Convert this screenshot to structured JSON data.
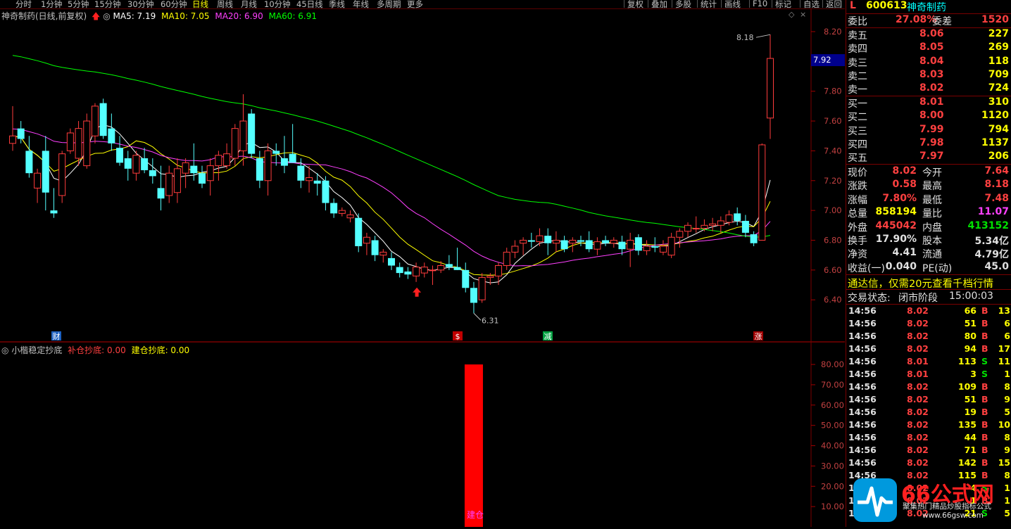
{
  "toolbar": {
    "timeframes": [
      "分时",
      "1分钟",
      "5分钟",
      "15分钟",
      "30分钟",
      "60分钟",
      "日线",
      "周线",
      "月线",
      "10分钟",
      "45日线",
      "季线",
      "年线",
      "多周期",
      "更多"
    ],
    "active_timeframe": "日线",
    "buttons": [
      "复权",
      "叠加",
      "多股",
      "统计",
      "画线",
      "F10",
      "标记",
      "自选",
      "返回"
    ]
  },
  "chart_header": {
    "title": "神奇制药(日线,前复权)",
    "ma5": "MA5: 7.19",
    "ma10": "MA10: 7.05",
    "ma20": "MA20: 6.90",
    "ma60": "MA60: 6.91",
    "colors": {
      "ma5": "#ffffff",
      "ma10": "#ffff00",
      "ma20": "#ff40ff",
      "ma60": "#00ff00"
    }
  },
  "price_axis": [
    "8.20",
    "8.00",
    "7.80",
    "7.60",
    "7.40",
    "7.20",
    "7.00",
    "6.80",
    "6.60",
    "6.40"
  ],
  "price_marker": "7.92",
  "high_label": "8.18",
  "low_label": "6.31",
  "event_markers": [
    "财",
    "$",
    "减",
    "涨"
  ],
  "indicator": {
    "name": "小楷稳定抄底",
    "line1": "补仓抄底: 0.00",
    "line2": "建仓抄底: 0.00",
    "axis": [
      "80.00",
      "70.00",
      "60.00",
      "50.00",
      "40.00",
      "30.00",
      "20.00",
      "10.00"
    ],
    "bar_label": "建仓",
    "bar_value": 80
  },
  "chart_data": {
    "type": "candlestick",
    "ylim": [
      6.3,
      8.25
    ],
    "candles": [
      [
        7.45,
        7.7,
        7.4,
        7.5
      ],
      [
        7.55,
        7.6,
        7.45,
        7.48
      ],
      [
        7.4,
        7.5,
        7.22,
        7.25
      ],
      [
        7.15,
        7.28,
        7.05,
        7.25
      ],
      [
        7.4,
        7.5,
        7.0,
        7.12
      ],
      [
        7.0,
        7.15,
        6.95,
        6.98
      ],
      [
        7.1,
        7.4,
        7.05,
        7.38
      ],
      [
        7.4,
        7.55,
        7.38,
        7.52
      ],
      [
        7.35,
        7.6,
        7.3,
        7.55
      ],
      [
        7.3,
        7.65,
        7.28,
        7.6
      ],
      [
        7.5,
        7.72,
        7.45,
        7.7
      ],
      [
        7.72,
        7.75,
        7.48,
        7.5
      ],
      [
        7.55,
        7.65,
        7.4,
        7.45
      ],
      [
        7.42,
        7.5,
        7.3,
        7.32
      ],
      [
        7.35,
        7.4,
        7.2,
        7.28
      ],
      [
        7.25,
        7.4,
        7.2,
        7.37
      ],
      [
        7.35,
        7.42,
        7.25,
        7.27
      ],
      [
        7.27,
        7.35,
        7.18,
        7.23
      ],
      [
        7.15,
        7.3,
        7.0,
        7.08
      ],
      [
        7.1,
        7.3,
        7.05,
        7.25
      ],
      [
        7.12,
        7.35,
        7.05,
        7.28
      ],
      [
        7.25,
        7.35,
        7.15,
        7.32
      ],
      [
        7.3,
        7.45,
        7.2,
        7.25
      ],
      [
        7.25,
        7.3,
        7.15,
        7.18
      ],
      [
        7.2,
        7.35,
        7.1,
        7.3
      ],
      [
        7.3,
        7.4,
        7.2,
        7.37
      ],
      [
        7.3,
        7.45,
        7.28,
        7.38
      ],
      [
        7.35,
        7.58,
        7.3,
        7.55
      ],
      [
        7.4,
        7.78,
        7.3,
        7.6
      ],
      [
        7.65,
        7.68,
        7.35,
        7.38
      ],
      [
        7.35,
        7.4,
        7.15,
        7.2
      ],
      [
        7.2,
        7.45,
        7.1,
        7.4
      ],
      [
        7.4,
        7.45,
        7.3,
        7.38
      ],
      [
        7.35,
        7.5,
        7.25,
        7.3
      ],
      [
        7.38,
        7.58,
        7.32,
        7.32
      ],
      [
        7.3,
        7.35,
        7.15,
        7.2
      ],
      [
        7.2,
        7.3,
        7.12,
        7.22
      ],
      [
        7.2,
        7.25,
        7.1,
        7.18
      ],
      [
        7.2,
        7.23,
        7.0,
        7.05
      ],
      [
        7.05,
        7.08,
        6.95,
        6.98
      ],
      [
        6.98,
        7.02,
        6.96,
        7.0
      ],
      [
        6.95,
        7.0,
        6.92,
        6.97
      ],
      [
        6.95,
        6.98,
        6.72,
        6.76
      ],
      [
        6.78,
        6.85,
        6.7,
        6.82
      ],
      [
        6.8,
        6.83,
        6.66,
        6.7
      ],
      [
        6.7,
        6.74,
        6.65,
        6.72
      ],
      [
        6.68,
        6.72,
        6.6,
        6.63
      ],
      [
        6.62,
        6.65,
        6.55,
        6.58
      ],
      [
        6.59,
        6.62,
        6.54,
        6.57
      ],
      [
        6.56,
        6.65,
        6.52,
        6.62
      ],
      [
        6.58,
        6.65,
        6.55,
        6.62
      ],
      [
        6.6,
        6.63,
        6.5,
        6.6
      ],
      [
        6.6,
        6.66,
        6.58,
        6.63
      ],
      [
        6.64,
        6.7,
        6.6,
        6.62
      ],
      [
        6.62,
        6.75,
        6.6,
        6.6
      ],
      [
        6.6,
        6.65,
        6.45,
        6.48
      ],
      [
        6.48,
        6.52,
        6.31,
        6.38
      ],
      [
        6.4,
        6.58,
        6.38,
        6.55
      ],
      [
        6.55,
        6.58,
        6.5,
        6.56
      ],
      [
        6.56,
        6.65,
        6.5,
        6.63
      ],
      [
        6.63,
        6.75,
        6.6,
        6.72
      ],
      [
        6.72,
        6.8,
        6.68,
        6.76
      ],
      [
        6.78,
        6.82,
        6.7,
        6.8
      ],
      [
        6.8,
        6.85,
        6.75,
        6.79
      ],
      [
        6.79,
        6.88,
        6.76,
        6.83
      ],
      [
        6.83,
        6.88,
        6.7,
        6.78
      ],
      [
        6.78,
        6.86,
        6.72,
        6.8
      ],
      [
        6.8,
        6.83,
        6.72,
        6.74
      ],
      [
        6.78,
        6.82,
        6.72,
        6.8
      ],
      [
        6.8,
        6.83,
        6.76,
        6.79
      ],
      [
        6.8,
        6.86,
        6.72,
        6.74
      ],
      [
        6.74,
        6.82,
        6.7,
        6.79
      ],
      [
        6.8,
        6.83,
        6.76,
        6.78
      ],
      [
        6.78,
        6.82,
        6.75,
        6.8
      ],
      [
        6.79,
        6.83,
        6.7,
        6.74
      ],
      [
        6.74,
        6.85,
        6.62,
        6.8
      ],
      [
        6.82,
        6.84,
        6.7,
        6.73
      ],
      [
        6.73,
        6.8,
        6.7,
        6.76
      ],
      [
        6.76,
        6.82,
        6.72,
        6.75
      ],
      [
        6.72,
        6.8,
        6.7,
        6.76
      ],
      [
        6.7,
        6.85,
        6.68,
        6.82
      ],
      [
        6.82,
        6.88,
        6.75,
        6.86
      ],
      [
        6.86,
        6.92,
        6.82,
        6.9
      ],
      [
        6.88,
        6.96,
        6.85,
        6.88
      ],
      [
        6.88,
        6.94,
        6.86,
        6.9
      ],
      [
        6.9,
        6.95,
        6.86,
        6.91
      ],
      [
        6.9,
        6.96,
        6.85,
        6.93
      ],
      [
        6.92,
        7.0,
        6.9,
        6.97
      ],
      [
        6.98,
        7.02,
        6.9,
        6.93
      ],
      [
        6.93,
        6.97,
        6.82,
        6.85
      ],
      [
        6.84,
        6.86,
        6.76,
        6.78
      ],
      [
        6.8,
        7.45,
        6.8,
        7.44
      ],
      [
        7.62,
        8.18,
        7.48,
        8.02
      ]
    ],
    "xlabel": "",
    "ylabel": ""
  },
  "quote": {
    "symbol_prefix": "L",
    "code": "600613",
    "name": "神奇制药",
    "weibi_label": "委比",
    "weibi": "27.08%",
    "weicha_label": "委差",
    "weicha": "1520",
    "asks": [
      {
        "label": "卖五",
        "price": "8.06",
        "vol": "227"
      },
      {
        "label": "卖四",
        "price": "8.05",
        "vol": "269"
      },
      {
        "label": "卖三",
        "price": "8.04",
        "vol": "118"
      },
      {
        "label": "卖二",
        "price": "8.03",
        "vol": "709"
      },
      {
        "label": "卖一",
        "price": "8.02",
        "vol": "724"
      }
    ],
    "bids": [
      {
        "label": "买一",
        "price": "8.01",
        "vol": "310"
      },
      {
        "label": "买二",
        "price": "8.00",
        "vol": "1120"
      },
      {
        "label": "买三",
        "price": "7.99",
        "vol": "794"
      },
      {
        "label": "买四",
        "price": "7.98",
        "vol": "1137"
      },
      {
        "label": "买五",
        "price": "7.97",
        "vol": "206"
      }
    ],
    "stats": [
      {
        "l1": "现价",
        "v1": "8.02",
        "c1": "red",
        "l2": "今开",
        "v2": "7.64",
        "c2": "red"
      },
      {
        "l1": "涨跌",
        "v1": "0.58",
        "c1": "red",
        "l2": "最高",
        "v2": "8.18",
        "c2": "red"
      },
      {
        "l1": "涨幅",
        "v1": "7.80%",
        "c1": "red",
        "l2": "最低",
        "v2": "7.48",
        "c2": "red"
      },
      {
        "l1": "总量",
        "v1": "858194",
        "c1": "yellow",
        "l2": "量比",
        "v2": "11.07",
        "c2": "mag"
      },
      {
        "l1": "外盘",
        "v1": "445042",
        "c1": "red",
        "l2": "内盘",
        "v2": "413152",
        "c2": "green"
      },
      {
        "l1": "换手",
        "v1": "17.90%",
        "c1": "white",
        "l2": "股本",
        "v2": "5.34亿",
        "c2": "white"
      },
      {
        "l1": "净资",
        "v1": "4.41",
        "c1": "white",
        "l2": "流通",
        "v2": "4.79亿",
        "c2": "white"
      },
      {
        "l1": "收益(一)",
        "v1": "0.040",
        "c1": "white",
        "l2": "PE(动)",
        "v2": "45.0",
        "c2": "white"
      }
    ],
    "notice": "通达信，仅需20元查看千档行情",
    "trade_status_label": "交易状态:",
    "trade_status": "闭市阶段",
    "trade_time": "15:00:03"
  },
  "ticks": [
    {
      "t": "14:56",
      "p": "8.02",
      "v": "66",
      "s": "B",
      "n": "13"
    },
    {
      "t": "14:56",
      "p": "8.02",
      "v": "51",
      "s": "B",
      "n": "6"
    },
    {
      "t": "14:56",
      "p": "8.02",
      "v": "80",
      "s": "B",
      "n": "6"
    },
    {
      "t": "14:56",
      "p": "8.02",
      "v": "94",
      "s": "B",
      "n": "17"
    },
    {
      "t": "14:56",
      "p": "8.01",
      "v": "113",
      "s": "S",
      "n": "11"
    },
    {
      "t": "14:56",
      "p": "8.01",
      "v": "3",
      "s": "S",
      "n": "1"
    },
    {
      "t": "14:56",
      "p": "8.02",
      "v": "109",
      "s": "B",
      "n": "8"
    },
    {
      "t": "14:56",
      "p": "8.02",
      "v": "51",
      "s": "B",
      "n": "9"
    },
    {
      "t": "14:56",
      "p": "8.02",
      "v": "19",
      "s": "B",
      "n": "5"
    },
    {
      "t": "14:56",
      "p": "8.02",
      "v": "135",
      "s": "B",
      "n": "10"
    },
    {
      "t": "14:56",
      "p": "8.02",
      "v": "44",
      "s": "B",
      "n": "8"
    },
    {
      "t": "14:56",
      "p": "8.02",
      "v": "71",
      "s": "B",
      "n": "9"
    },
    {
      "t": "14:56",
      "p": "8.02",
      "v": "142",
      "s": "B",
      "n": "15"
    },
    {
      "t": "14:56",
      "p": "8.02",
      "v": "115",
      "s": "B",
      "n": "8"
    },
    {
      "t": "14:56",
      "p": "8.02",
      "v": "4",
      "s": "S",
      "n": "1"
    },
    {
      "t": "14:56",
      "p": "8.02",
      "v": "1",
      "s": "B",
      "n": "1"
    },
    {
      "t": "14:57",
      "p": "8.02",
      "v": "21",
      "s": "S",
      "n": "5"
    }
  ],
  "watermark": {
    "brand": "66公式网",
    "tagline": "聚集热门精品炒股指标公式",
    "url": "www.66gsw.com"
  }
}
